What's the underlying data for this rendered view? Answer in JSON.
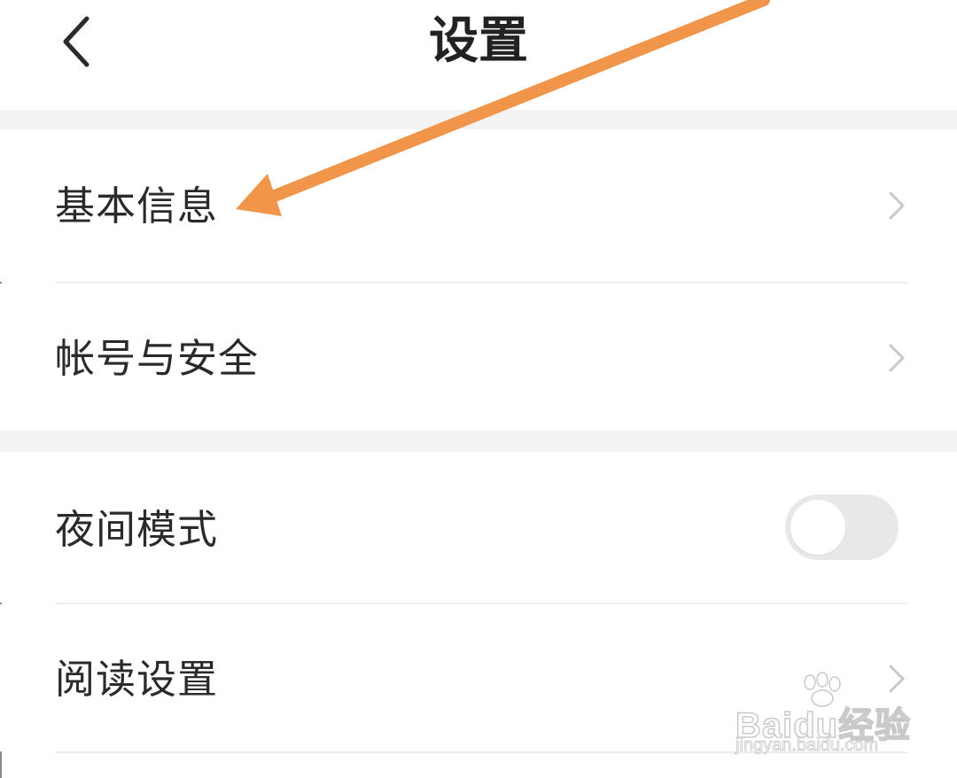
{
  "header": {
    "title": "设置",
    "back_icon": "chevron-left-icon"
  },
  "settings": {
    "basic_info": "基本信息",
    "account_security": "帐号与安全",
    "night_mode": "夜间模式",
    "night_mode_enabled": false,
    "reading_settings": "阅读设置"
  },
  "annotation": {
    "arrow_color": "#F0954A"
  },
  "watermark": {
    "brand": "Baidu经验",
    "url": "jingyan.baidu.com"
  },
  "colors": {
    "section_gap": "#F3F3F3",
    "chevron": "#C8C8C8",
    "toggle_off": "#E8E8E8"
  }
}
